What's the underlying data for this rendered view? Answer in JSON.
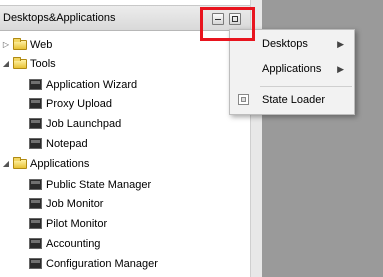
{
  "panel": {
    "title": "Desktops&Applications",
    "minimize_icon": "minimize-icon",
    "maximize_icon": "maximize-icon"
  },
  "tree": {
    "web": {
      "label": "Web",
      "expanded": false
    },
    "tools": {
      "label": "Tools",
      "expanded": true,
      "items": [
        "Application Wizard",
        "Proxy Upload",
        "Job Launchpad",
        "Notepad"
      ]
    },
    "applications": {
      "label": "Applications",
      "expanded": true,
      "items": [
        "Public State Manager",
        "Job Monitor",
        "Pilot Monitor",
        "Accounting",
        "Configuration Manager"
      ]
    }
  },
  "context_menu": {
    "items": [
      {
        "label": "Desktops",
        "submenu": true
      },
      {
        "label": "Applications",
        "submenu": true
      },
      {
        "label": "State Loader",
        "icon": "state-loader-icon"
      }
    ]
  },
  "colors": {
    "highlight_box": "#e8141e",
    "folder": "#e8c234"
  }
}
